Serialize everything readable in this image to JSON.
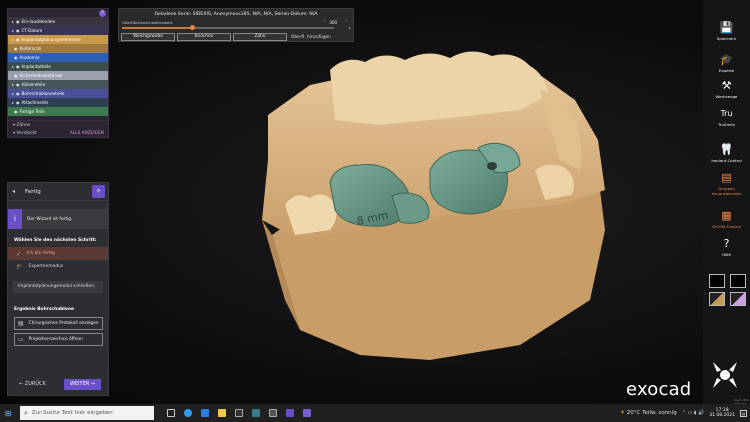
{
  "object_panel": {
    "help_icon": "?",
    "rows": [
      {
        "label": "Ein-/ausblenden",
        "bg": "#3a3440",
        "tri": "▸"
      },
      {
        "label": "CT-Datum",
        "bg": "#3b3353",
        "tri": "▸"
      },
      {
        "label": "Implantatplanungselemente",
        "bg": "#c99a4d",
        "tri": "▸"
      },
      {
        "label": "Kieferscan",
        "bg": "#9e7a3f",
        "tri": ""
      },
      {
        "label": "Anatomie",
        "bg": "#2e5fb8",
        "tri": ""
      },
      {
        "label": "Implantatteile",
        "bg": "#3b4f4a",
        "tri": "▸"
      },
      {
        "label": "Sicherheitsabstände",
        "bg": "#9b9fb0",
        "tri": ""
      },
      {
        "label": "Hülsenteile",
        "bg": "#44545a",
        "tri": "▸"
      },
      {
        "label": "Bohrschablonenteile",
        "bg": "#4a4f9a",
        "tri": "▸"
      },
      {
        "label": "Attachments",
        "bg": "#2f3f52",
        "tri": "▸"
      },
      {
        "label": "Fertige Teile",
        "bg": "#3f7a4f",
        "tri": ""
      }
    ],
    "teeth_label": "Zähne",
    "hidden_label": "Versteckt",
    "show_all": "ALLE ANZEIGEN"
  },
  "top_bar": {
    "series": "Geladene Serie: SIDEXIS, Anonymous185, N/A, N/A, Serien-Datum: N/A",
    "threshold_label": "Oberflächenschwellenwert",
    "threshold_value": "300",
    "threshold_fraction": 0.33,
    "nav_left": "‹",
    "nav_right": "›",
    "buttons": [
      "Weichgewebe",
      "Knochen",
      "Zahn"
    ],
    "surface_add": "Oberfl. hinzufügen",
    "expand": "›"
  },
  "wizard": {
    "title": "Fertig",
    "info": "Der Wizard ist fertig.",
    "choose_label": "Wählen Sie den nächsten Schritt:",
    "options": [
      {
        "label": "Ich bin fertig",
        "selected": true
      },
      {
        "label": "Expertenmodus",
        "selected": false
      }
    ],
    "close_module": "Implantatplanungsmodul schließen.",
    "results_label": "Ergebnis Bohrschablone",
    "result_buttons": [
      "Chirurgisches Protokoll anzeigen",
      "Projektverzeichnis öffnen"
    ],
    "back": "ZURÜCK",
    "next": "WEITER"
  },
  "right_toolbar": {
    "items": [
      {
        "label": "Speichern",
        "icon": "save-icon",
        "glyph": "💾"
      },
      {
        "label": "Experte",
        "icon": "graduation-cap-icon",
        "glyph": "🎓"
      },
      {
        "label": "Werkzeuge",
        "icon": "tools-icon",
        "glyph": "⚒"
      },
      {
        "label": "TruSmile",
        "icon": "trusmile-icon",
        "glyph": "Tru"
      },
      {
        "label": "Implant-Control",
        "icon": "implant-icon",
        "glyph": "🦷"
      },
      {
        "label": "Gruppen ein/ausblenden",
        "icon": "groups-icon",
        "glyph": "▤"
      },
      {
        "label": "DICOM-Control",
        "icon": "dicom-icon",
        "glyph": "▦"
      },
      {
        "label": "Hilfe",
        "icon": "help-icon",
        "glyph": "?"
      }
    ]
  },
  "brand": "exocad",
  "version": "beyt-v3.0-7737/64",
  "taskbar": {
    "search_placeholder": "Zur Suche Text hier eingeben",
    "weather": "20°C  Teilw. sonnig",
    "time": "17:18",
    "date": "31.08.2021"
  }
}
